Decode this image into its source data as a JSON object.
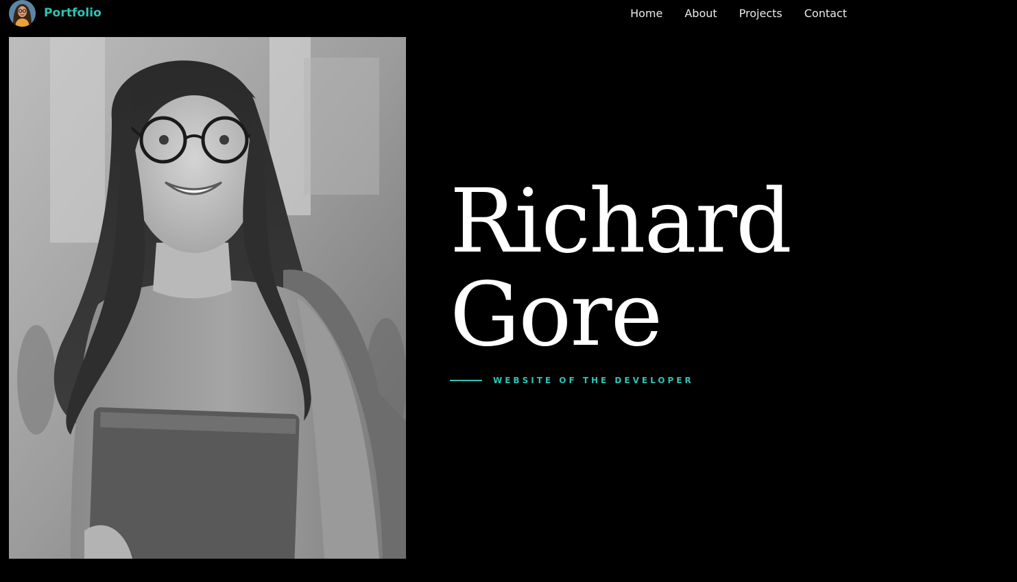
{
  "header": {
    "brand": {
      "avatar_icon": "avatar-icon",
      "label": "Portfolio"
    },
    "nav": [
      {
        "label": "Home"
      },
      {
        "label": "About"
      },
      {
        "label": "Projects"
      },
      {
        "label": "Contact"
      }
    ]
  },
  "hero": {
    "first_name": "Richard",
    "last_name": "Gore",
    "tagline": "WEBSITE OF THE DEVELOPER",
    "portrait": "portrait-photo"
  },
  "colors": {
    "background": "#000000",
    "accent": "#2ec4b6",
    "text": "#ffffff",
    "nav_text": "#ececec"
  }
}
